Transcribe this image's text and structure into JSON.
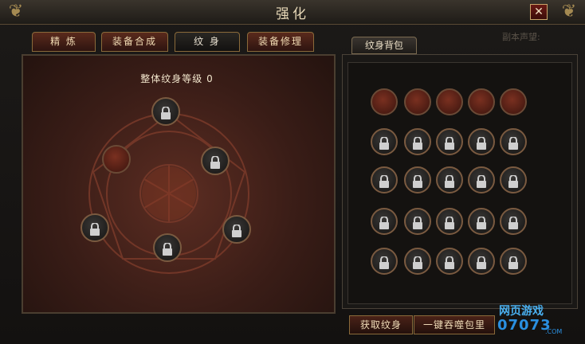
{
  "window": {
    "title": "强化",
    "close_label": "✕"
  },
  "reputation_label": "副本声望:",
  "tabs": [
    {
      "label": "精 炼",
      "active": false
    },
    {
      "label": "装备合成",
      "active": false
    },
    {
      "label": "纹 身",
      "active": true
    },
    {
      "label": "装备修理",
      "active": false
    }
  ],
  "tattoo_panel": {
    "level_label": "整体纹身等级 0"
  },
  "bag": {
    "tab_label": "纹身背包",
    "empty_slots": 5,
    "locked_slots": 20
  },
  "buttons": {
    "acquire": "获取纹身",
    "devour": "一键吞噬包里"
  },
  "watermark": {
    "line1": "网页游戏",
    "line2": "07073",
    "suffix": ".COM"
  },
  "colors": {
    "accent": "#c9a46a",
    "panel": "#3a1d17",
    "text": "#f2e6cc"
  }
}
